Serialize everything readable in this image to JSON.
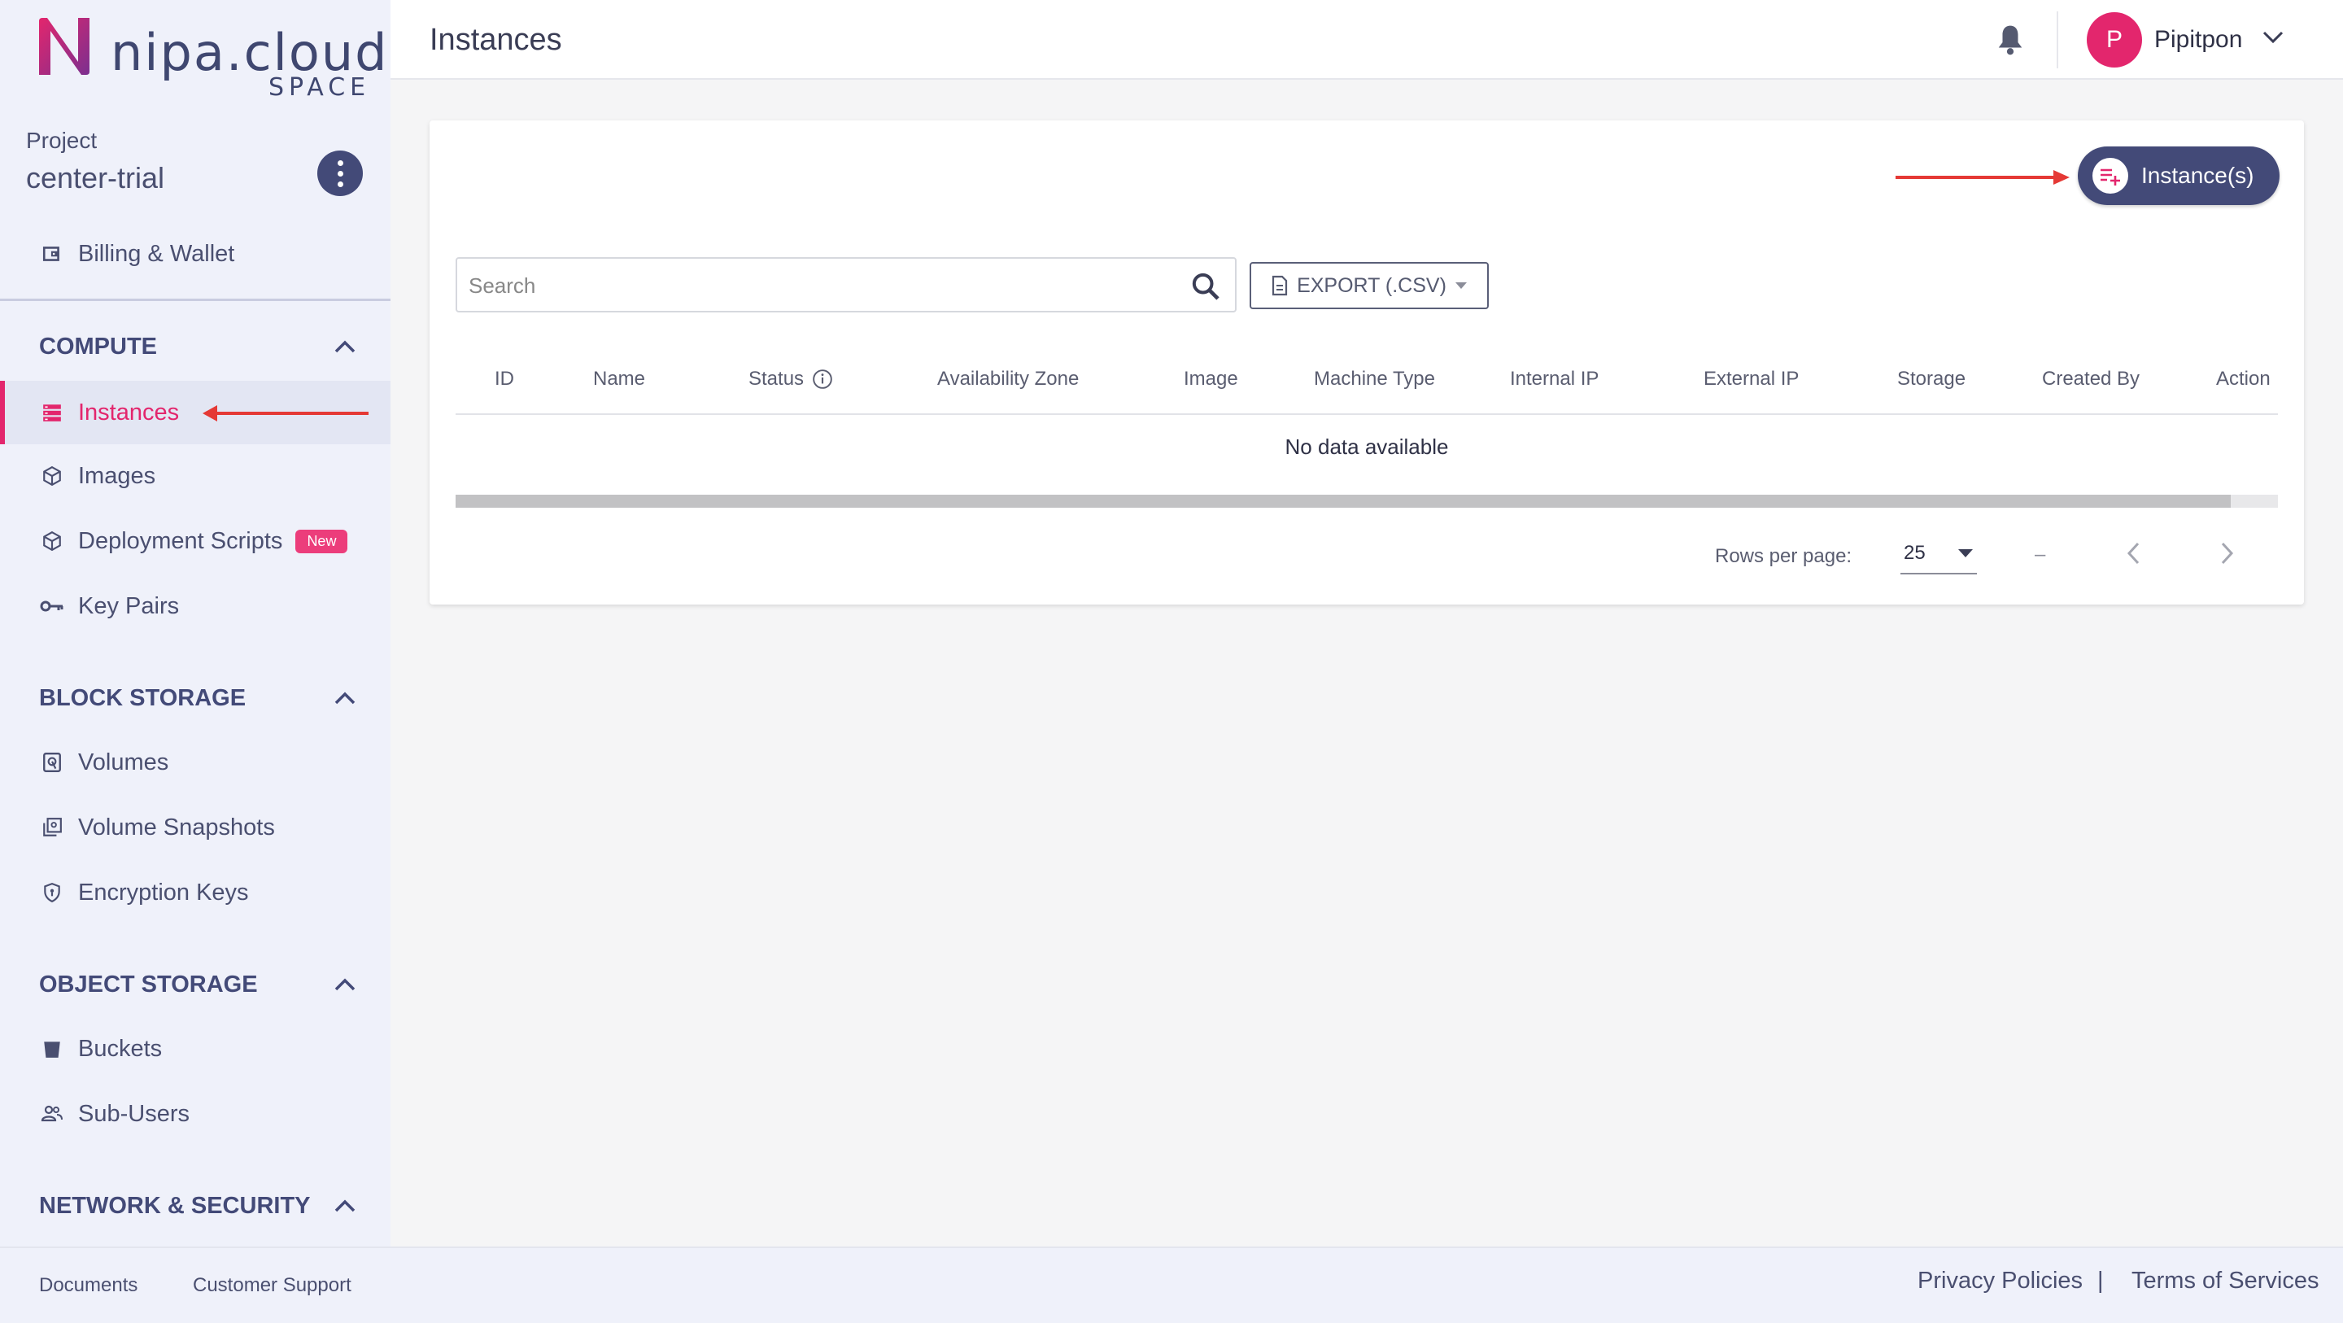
{
  "brand": {
    "name": "nipa.cloud",
    "sub": "SPACE",
    "accent": "#e3266d",
    "primary": "#434a78"
  },
  "project": {
    "label": "Project",
    "name": "center-trial",
    "menu_icon": "more-vertical-icon"
  },
  "sidebar": {
    "billing": {
      "label": "Billing & Wallet",
      "icon": "wallet-icon"
    },
    "sections": [
      {
        "title": "COMPUTE",
        "items": [
          {
            "label": "Instances",
            "icon": "server-icon",
            "active": true
          },
          {
            "label": "Images",
            "icon": "cube-icon"
          },
          {
            "label": "Deployment Scripts",
            "icon": "cube-icon",
            "badge": "New"
          },
          {
            "label": "Key Pairs",
            "icon": "key-icon"
          }
        ]
      },
      {
        "title": "BLOCK STORAGE",
        "items": [
          {
            "label": "Volumes",
            "icon": "disk-icon"
          },
          {
            "label": "Volume Snapshots",
            "icon": "snapshot-icon"
          },
          {
            "label": "Encryption Keys",
            "icon": "shield-icon"
          }
        ]
      },
      {
        "title": "OBJECT STORAGE",
        "items": [
          {
            "label": "Buckets",
            "icon": "bucket-icon"
          },
          {
            "label": "Sub-Users",
            "icon": "users-icon"
          }
        ]
      },
      {
        "title": "NETWORK & SECURITY",
        "items": []
      }
    ]
  },
  "footer": {
    "documents": "Documents",
    "support": "Customer Support",
    "privacy": "Privacy Policies",
    "separator": "|",
    "terms": "Terms of Services"
  },
  "header": {
    "title": "Instances",
    "user_initial": "P",
    "user_name": "Pipitpon"
  },
  "main": {
    "create_button": "Instance(s)",
    "search_placeholder": "Search",
    "export_label": "EXPORT (.CSV)",
    "columns": [
      "ID",
      "Name",
      "Status",
      "Availability Zone",
      "Image",
      "Machine Type",
      "Internal IP",
      "External IP",
      "Storage",
      "Created By",
      "Action"
    ],
    "empty_text": "No data available",
    "rows_per_page_label": "Rows per page:",
    "rows_per_page": "25",
    "page_range": "–"
  }
}
